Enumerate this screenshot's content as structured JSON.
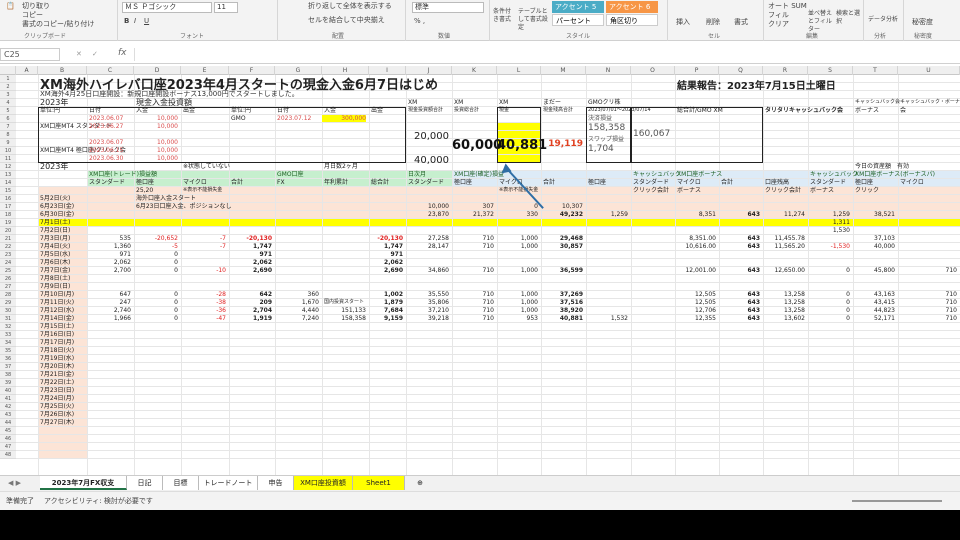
{
  "ribbon": {
    "clipboard": {
      "items": [
        "切り取り",
        "コピー",
        "書式のコピー/貼り付け"
      ],
      "label": "クリップボード"
    },
    "font": {
      "name": "ＭＳ Ｐゴシック",
      "size": "11",
      "label": "フォント"
    },
    "align": {
      "wrap": "折り返して全体を表示する",
      "merge": "セルを結合して中央揃え",
      "label": "配置"
    },
    "number": {
      "format": "標準",
      "label": "数値"
    },
    "styles": {
      "cond": "条件付き書式",
      "table": "テーブルとして書式設定",
      "cells": [
        "アクセント 5",
        "アクセント 6",
        "パーセント",
        "角区切り"
      ],
      "label": "スタイル"
    },
    "cells": {
      "items": [
        "挿入",
        "削除",
        "書式"
      ],
      "label": "セル"
    },
    "edit": {
      "items": [
        "オート SUM",
        "フィル",
        "クリア",
        "並べ替えとフィルター",
        "検索と選択"
      ],
      "label": "編集"
    },
    "analysis": {
      "item": "データ分析",
      "label": "分析"
    },
    "privacy": {
      "item": "秘密度",
      "label": "秘密度"
    }
  },
  "formula_bar": {
    "name_box": "C25",
    "fx": "fx"
  },
  "columns": [
    "A",
    "B",
    "C",
    "D",
    "E",
    "F",
    "G",
    "H",
    "I",
    "J",
    "K",
    "L",
    "M",
    "N",
    "O",
    "P",
    "Q",
    "R",
    "S",
    "T",
    "U"
  ],
  "rows": [
    "1",
    "2",
    "3",
    "4",
    "5",
    "6",
    "7",
    "8",
    "9",
    "10",
    "11",
    "12",
    "13",
    "14",
    "15",
    "16",
    "17",
    "18",
    "19",
    "20",
    "21",
    "22",
    "23",
    "24",
    "25",
    "26",
    "27",
    "28",
    "29",
    "30",
    "31",
    "32",
    "33",
    "34",
    "35",
    "36",
    "37",
    "38",
    "39",
    "40",
    "41",
    "42",
    "43",
    "44",
    "45",
    "46",
    "47",
    "48"
  ],
  "sheet": {
    "title": "XM海外ハイレバ口座2023年4月スタートの現金入金6月7日はじめ",
    "result": "結果報告：2023年7月15日土曜日",
    "note": "XM海外4月25日口座開設：新規口座開設ボーナス13,000円でスタートしました。",
    "year": "2023年",
    "deposit_label": "現金入金投資額",
    "tbl_headers": [
      "単位:円",
      "日付",
      "入金",
      "出金",
      "単位:円",
      "日付",
      "入金",
      "出金"
    ],
    "xm_std": "XM口座MT4 スタンダード",
    "xm_micro": "XM口座MT4 極口座/クリック会",
    "gmo": "GMO",
    "d1": [
      "2023.06.07",
      "2023.06.27",
      "",
      "2023.06.07",
      "2023.06.15",
      "2023.06.30"
    ],
    "v1": [
      "10,000",
      "10,000",
      "",
      "10,000",
      "10,000",
      "10,000"
    ],
    "gmo_date": "2023.07.12",
    "gmo_amt": "300,000",
    "hdr_k": [
      "XM",
      "XM",
      "XM",
      "まだー",
      "GMOクリ株"
    ],
    "hdr_k2": [
      "現金投資額合計",
      "投資総合計",
      "現金",
      "現金残高合計",
      "2023/07/01〜2023/07/14"
    ],
    "left_vals": [
      "20,000",
      "40,000"
    ],
    "big1": "60,000",
    "big2": "40,881",
    "big3": "19,119",
    "gmo_box": [
      "決済損益",
      "158,358",
      "スワップ損益",
      "1,704"
    ],
    "gmo_total": "160,067",
    "header_p": "総合計/GMO XM",
    "header_s": "タリタリキャッシュバック会",
    "header_t": [
      "キャッシュバック会",
      "ボーナス",
      "キャッシュバック・ボーナス 会(クリック)",
      "会"
    ],
    "y2023": "2023年",
    "r12note": "※状態していない",
    "r12note2": "月日数2ヶ月",
    "r12note3": "今日の資産額　有効",
    "sec_headers": [
      "XM口座(トレード)損益額",
      "GMO口座",
      "日次月",
      "XM口座(確定)損益",
      "キャッシュバック",
      "XM口座ボーナス",
      "キャッシュバック",
      "XM口座ボーナス(ボーナスパ)"
    ],
    "sub_headers": [
      "スタンダード",
      "極口座",
      "マイクロ",
      "合計",
      "FX",
      "年利累計",
      "総合計",
      "スタンダード",
      "極口座",
      "マイクロ",
      "合計",
      "極口座",
      "スタンダード",
      "マイクロ",
      "合計",
      "口座残高",
      "スタンダード",
      "極口座",
      "マイクロ"
    ],
    "sub2": [
      "25,20",
      "※表示不能損失金",
      "※表示不能損失金",
      "クリック会計",
      "ボーナス",
      "クリック会計",
      "ボーナス",
      "クリック"
    ],
    "day_rows": [
      {
        "r": "5月2日(火)",
        "note": "海外口座入金スタート"
      },
      {
        "r": "6月23日(金)",
        "note": "6月23日口座入金、ポジションなし"
      },
      {
        "r": "6月30日(金)",
        "yellow": true,
        "vals": [
          "",
          "",
          "",
          "",
          "",
          "",
          "",
          "23,870",
          "21,372",
          "330",
          "49,232",
          "1,259",
          "",
          "8,351",
          "643",
          "11,274",
          "1,259",
          "38,521",
          ""
        ]
      },
      {
        "r": "7月1日(土)",
        "vals": [
          "",
          "",
          "",
          "",
          "",
          "",
          "",
          "",
          "",
          "",
          "",
          "",
          "",
          "",
          "",
          "",
          "1,311",
          "",
          ""
        ]
      },
      {
        "r": "7月2日(日)",
        "vals": [
          "",
          "",
          "",
          "",
          "",
          "",
          "",
          "",
          "",
          "",
          "",
          "",
          "",
          "",
          "",
          "",
          "1,530",
          "",
          ""
        ]
      },
      {
        "r": "7月3日(月)",
        "vals": [
          "535",
          "-20,652",
          "-7",
          "-20,130",
          "",
          "",
          "-20,130",
          "27,258",
          "710",
          "1,000",
          "29,468",
          "",
          "",
          "8,351.00",
          "643",
          "11,455.78",
          "",
          "37,103",
          ""
        ]
      },
      {
        "r": "7月4日(火)",
        "vals": [
          "1,360",
          "-5",
          "-7",
          "1,747",
          "",
          "",
          "1,747",
          "28,147",
          "710",
          "1,000",
          "30,857",
          "",
          "",
          "10,616.00",
          "643",
          "11,565.20",
          "-1,530",
          "40,000",
          ""
        ]
      },
      {
        "r": "7月5日(水)",
        "vals": [
          "971",
          "0",
          "",
          "971",
          "",
          "",
          "971",
          "",
          "",
          "",
          "",
          "",
          "",
          "",
          "",
          "",
          "",
          "",
          ""
        ]
      },
      {
        "r": "7月6日(木)",
        "vals": [
          "2,062",
          "0",
          "",
          "2,062",
          "",
          "",
          "2,062",
          "",
          "",
          "",
          "",
          "",
          "",
          "",
          "",
          "",
          "",
          "",
          ""
        ]
      },
      {
        "r": "7月7日(金)",
        "vals": [
          "2,700",
          "0",
          "-10",
          "2,690",
          "",
          "",
          "2,690",
          "34,860",
          "710",
          "1,000",
          "36,599",
          "",
          "",
          "12,001.00",
          "643",
          "12,650.00",
          "0",
          "45,800",
          "710"
        ]
      },
      {
        "r": "7月8日(土)",
        "vals": []
      },
      {
        "r": "7月9日(日)",
        "vals": []
      },
      {
        "r": "7月10日(月)",
        "vals": [
          "647",
          "0",
          "-28",
          "642",
          "360",
          "",
          "1,002",
          "35,550",
          "710",
          "1,000",
          "37,269",
          "",
          "",
          "12,505",
          "643",
          "13,258",
          "0",
          "43,163",
          "710"
        ]
      },
      {
        "r": "7月11日(火)",
        "vals": [
          "247",
          "0",
          "-38",
          "209",
          "1,670",
          "",
          "1,879",
          "35,806",
          "710",
          "1,000",
          "37,516",
          "",
          "",
          "12,505",
          "643",
          "13,258",
          "0",
          "43,415",
          "710"
        ]
      },
      {
        "r": "7月12日(水)",
        "vals": [
          "2,740",
          "0",
          "-36",
          "2,704",
          "4,440",
          "151,133",
          "7,684",
          "37,210",
          "710",
          "1,000",
          "38,920",
          "",
          "",
          "12,706",
          "643",
          "13,258",
          "0",
          "44,823",
          "710"
        ]
      },
      {
        "r": "7月14日(金)",
        "vals": [
          "1,966",
          "0",
          "-47",
          "1,919",
          "7,240",
          "158,358",
          "9,159",
          "39,218",
          "710",
          "953",
          "40,881",
          "1,532",
          "",
          "12,355",
          "643",
          "13,602",
          "0",
          "52,171",
          "710"
        ]
      },
      {
        "r": "7月15日(土)",
        "vals": []
      },
      {
        "r": "7月16日(日)",
        "vals": []
      },
      {
        "r": "7月17日(月)",
        "vals": []
      },
      {
        "r": "7月18日(火)",
        "vals": []
      },
      {
        "r": "7月19日(水)",
        "vals": []
      },
      {
        "r": "7月20日(木)",
        "vals": []
      },
      {
        "r": "7月21日(金)",
        "vals": []
      },
      {
        "r": "7月22日(土)",
        "vals": []
      },
      {
        "r": "7月23日(日)",
        "vals": []
      },
      {
        "r": "7月24日(月)",
        "vals": []
      },
      {
        "r": "7月25日(火)",
        "vals": []
      },
      {
        "r": "7月26日(水)",
        "vals": []
      },
      {
        "r": "7月27日(木)",
        "vals": []
      }
    ],
    "gmo_start": "国内投資スタート",
    "r17_extra": [
      "10,000",
      "307",
      "0",
      "10,307"
    ]
  },
  "tabs": [
    "2023年7月FX収支",
    "日記",
    "目標",
    "トレードノート",
    "申告",
    "XM口座投資額",
    "Sheet1"
  ],
  "tab_add": "⊕",
  "status": {
    "ready": "準備完了",
    "access": "アクセシビリティ: 検討が必要です"
  },
  "colors": {
    "yellow": "#ffff00",
    "green_header": "#c6efce",
    "blue_header": "#ddebf7",
    "orange_row": "#fce4d6"
  }
}
